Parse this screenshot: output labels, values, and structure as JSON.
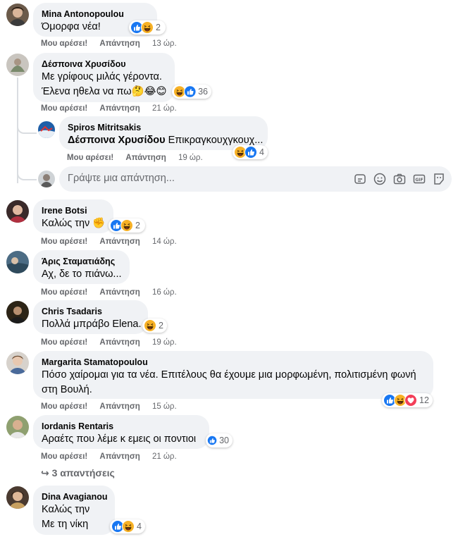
{
  "reactions_count_text": {
    "c1": "2",
    "c2": "36",
    "r1": "4",
    "c3": "2",
    "c6": "2",
    "c7": "12",
    "c8": "30",
    "c9": "4"
  },
  "actions": {
    "like": "Μου αρέσει!",
    "reply": "Απάντηση"
  },
  "comments": [
    {
      "name": "Mina Antonopoulou",
      "lines": [
        "Όμορφα νέα!"
      ],
      "time": "13 ώρ."
    },
    {
      "name": "Δέσποινα Χρυσίδου",
      "lines": [
        "Με γρίφους μιλάς γέροντα.",
        "Έλενα ηθελα να πω"
      ],
      "line2_emoji": "🤔😂😊",
      "time": "21 ώρ."
    },
    {
      "name": "Irene Botsi",
      "lines": [
        "Καλώς την"
      ],
      "line_emoji": "✊",
      "time": "14 ώρ."
    },
    {
      "name": "Άρις Σταματιάδης",
      "lines": [
        "Αχ, δε το πιάνω..."
      ],
      "time": "16 ώρ."
    },
    {
      "name": "Chris Tsadaris",
      "lines": [
        "Πολλά μπράβο Elena."
      ],
      "time": "19 ώρ."
    },
    {
      "name": "Margarita Stamatopoulou",
      "lines": [
        "Πόσο χαίρομαι για τα νέα. Επιτέλους θα έχουμε μια μορφωμένη, πολιτισμένη φωνή στη Βουλή."
      ],
      "time": "15 ώρ."
    },
    {
      "name": "Iordanis Rentaris",
      "lines": [
        "Αραέτς που λέμε κ εμεις οι ποντιοι"
      ],
      "time": "21 ώρ."
    },
    {
      "name": "Dina Avagianou",
      "lines": [
        "Καλώς την",
        "Με τη νίκη"
      ],
      "time": ""
    }
  ],
  "reply": {
    "name": "Spiros Mitritsakis",
    "mention": "Δέσποινα Χρυσίδου",
    "text": "Επικραγκουχγκουχ...",
    "time": "19 ώρ."
  },
  "reply_box": {
    "placeholder": "Γράψτε μια απάντηση..."
  },
  "more_replies": "3 απαντήσεις",
  "colors": {
    "like_blue": "#1877f2",
    "haha_yellow": "#f7b125",
    "love_red": "#f33e58",
    "bubble": "#f0f2f5",
    "meta": "#65676b"
  }
}
